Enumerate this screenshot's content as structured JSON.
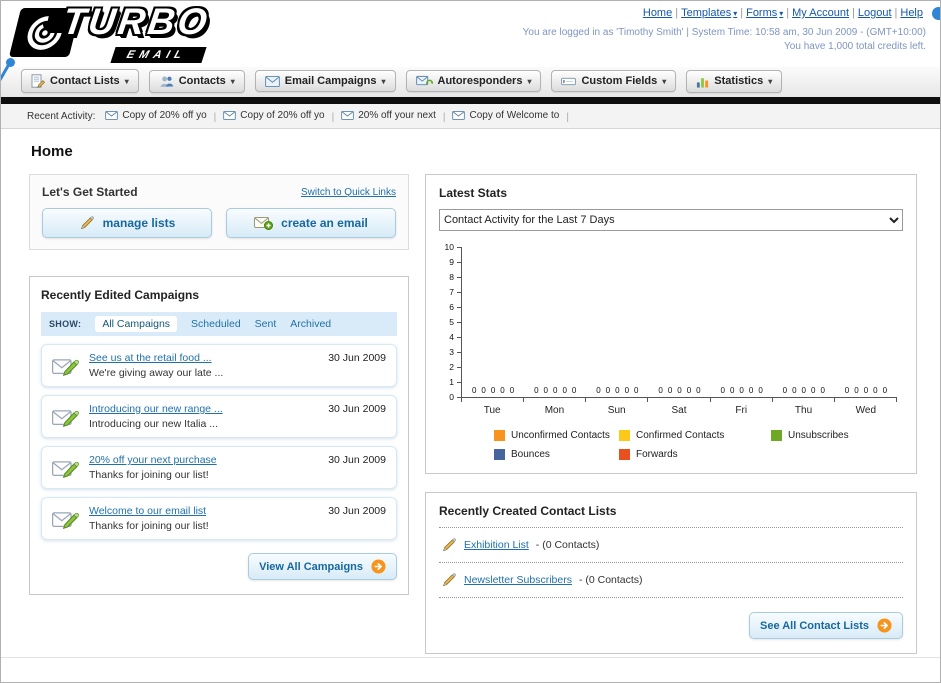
{
  "page_title": "Home",
  "header": {
    "logo": {
      "main": "TURBO",
      "sub": "EMAIL"
    },
    "top_links": [
      {
        "label": "Home",
        "dropdown": false
      },
      {
        "label": "Templates",
        "dropdown": true
      },
      {
        "label": "Forms",
        "dropdown": true
      },
      {
        "label": "My Account",
        "dropdown": false
      },
      {
        "label": "Logout",
        "dropdown": false
      },
      {
        "label": "Help",
        "dropdown": false
      }
    ],
    "login_info": "You are logged in as 'Timothy Smith' | System Time: 10:58 am, 30 Jun 2009 - (GMT+10:00)",
    "credits_info": "You have 1,000 total credits left."
  },
  "nav": {
    "items": [
      {
        "label": "Contact Lists",
        "icon": "list-pencil"
      },
      {
        "label": "Contacts",
        "icon": "contacts"
      },
      {
        "label": "Email Campaigns",
        "icon": "envelope"
      },
      {
        "label": "Autoresponders",
        "icon": "autoresponder"
      },
      {
        "label": "Custom Fields",
        "icon": "custom-field"
      },
      {
        "label": "Statistics",
        "icon": "stats-bars"
      }
    ]
  },
  "recent_activity": {
    "label": "Recent Activity:",
    "items": [
      "Copy of 20% off yo",
      "Copy of 20% off yo",
      "20% off your next",
      "Copy of Welcome to"
    ]
  },
  "get_started": {
    "title": "Let's Get Started",
    "switch_link": "Switch to Quick Links",
    "buttons": [
      {
        "label": "manage lists",
        "icon": "pencil"
      },
      {
        "label": "create an email",
        "icon": "envelope-plus"
      }
    ]
  },
  "campaigns": {
    "title": "Recently Edited Campaigns",
    "show_label": "SHOW:",
    "tabs": [
      "All Campaigns",
      "Scheduled",
      "Sent",
      "Archived"
    ],
    "active_tab": "All Campaigns",
    "items": [
      {
        "title": "See us at the retail food ...",
        "subtitle": "We're giving away our late ...",
        "date": "30 Jun 2009"
      },
      {
        "title": "Introducing our new range ...",
        "subtitle": "Introducing our new Italia ...",
        "date": "30 Jun 2009"
      },
      {
        "title": "20% off your next purchase",
        "subtitle": "Thanks for joining our list!",
        "date": "30 Jun 2009"
      },
      {
        "title": "Welcome to our email list",
        "subtitle": "Thanks for joining our list!",
        "date": "30 Jun 2009"
      }
    ],
    "view_all": {
      "label": "View All Campaigns",
      "icon": "arrow-circle"
    }
  },
  "stats": {
    "title": "Latest Stats",
    "period_selected": "Contact Activity for the Last 7 Days"
  },
  "chart_data": {
    "type": "bar",
    "title": "Contact Activity for the Last 7 Days",
    "categories": [
      "Tue",
      "Mon",
      "Sun",
      "Sat",
      "Fri",
      "Thu",
      "Wed"
    ],
    "series": [
      {
        "name": "Unconfirmed Contacts",
        "color": "#f7941d",
        "values": [
          0,
          0,
          0,
          0,
          0,
          0,
          0
        ]
      },
      {
        "name": "Confirmed Contacts",
        "color": "#fcc918",
        "values": [
          0,
          0,
          0,
          0,
          0,
          0,
          0
        ]
      },
      {
        "name": "Unsubscribes",
        "color": "#6da925",
        "values": [
          0,
          0,
          0,
          0,
          0,
          0,
          0
        ]
      },
      {
        "name": "Bounces",
        "color": "#46659c",
        "values": [
          0,
          0,
          0,
          0,
          0,
          0,
          0
        ]
      },
      {
        "name": "Forwards",
        "color": "#e8501d",
        "values": [
          0,
          0,
          0,
          0,
          0,
          0,
          0
        ]
      }
    ],
    "ylim": [
      0,
      10
    ],
    "yticks": [
      0,
      1,
      2,
      3,
      4,
      5,
      6,
      7,
      8,
      9,
      10
    ],
    "grid": false,
    "legend_position": "bottom",
    "data_labels": true
  },
  "contact_lists": {
    "title": "Recently Created Contact Lists",
    "items": [
      {
        "name": "Exhibition List",
        "detail": "- (0 Contacts)",
        "icon": "pencil"
      },
      {
        "name": "Newsletter Subscribers",
        "detail": "- (0 Contacts)",
        "icon": "pencil"
      }
    ],
    "see_all": {
      "label": "See All Contact Lists",
      "icon": "arrow-circle"
    }
  }
}
